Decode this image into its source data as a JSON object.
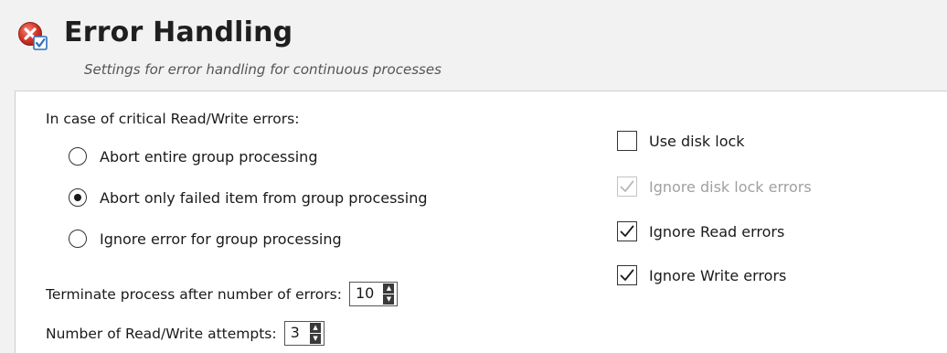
{
  "header": {
    "title": "Error Handling",
    "subtitle": "Settings for error handling for continuous processes",
    "icon": "error-settings-icon"
  },
  "critical_errors": {
    "label": "In case of critical Read/Write errors:",
    "options": [
      {
        "label": "Abort entire group processing",
        "selected": false
      },
      {
        "label": "Abort only failed item from group processing",
        "selected": true
      },
      {
        "label": "Ignore error for group processing",
        "selected": false
      }
    ]
  },
  "terminate_after": {
    "label": "Terminate process after number of errors:",
    "value": "10"
  },
  "rw_attempts": {
    "label": "Number of Read/Write attempts:",
    "value": "3"
  },
  "checkboxes": [
    {
      "label": "Use disk lock",
      "checked": false,
      "enabled": true
    },
    {
      "label": "Ignore disk lock errors",
      "checked": true,
      "enabled": false
    },
    {
      "label": "Ignore Read errors",
      "checked": true,
      "enabled": true
    },
    {
      "label": "Ignore Write errors",
      "checked": true,
      "enabled": true
    }
  ],
  "colors": {
    "accent_red": "#d8392b",
    "accent_blue": "#2f6fb8"
  }
}
